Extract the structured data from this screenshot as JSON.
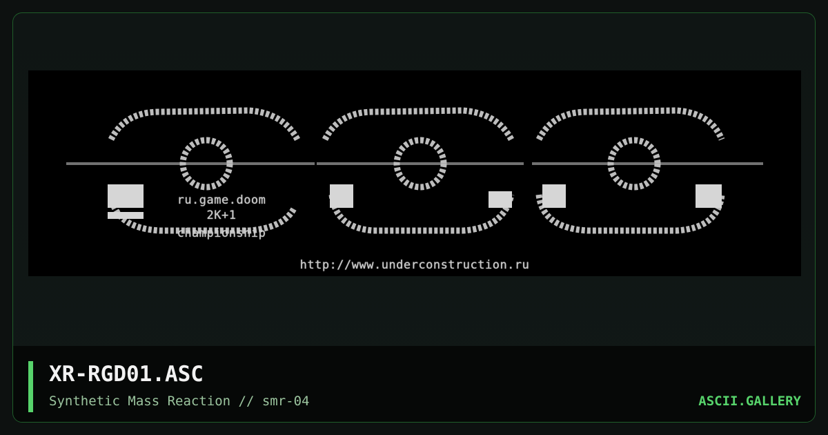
{
  "artwork": {
    "art_text": {
      "caption_line1": "ru.game.doom",
      "caption_line2": "2K+1",
      "caption_line3": "championship",
      "url": "http://www.underconstruction.ru"
    },
    "glyph_color": "#c9c9c9",
    "background_color": "#000000"
  },
  "footer": {
    "title": "XR-RGD01.ASC",
    "subtitle": "Synthetic Mass Reaction // smr-04",
    "brand": "ASCII.GALLERY",
    "accent_color": "#57d36b"
  }
}
